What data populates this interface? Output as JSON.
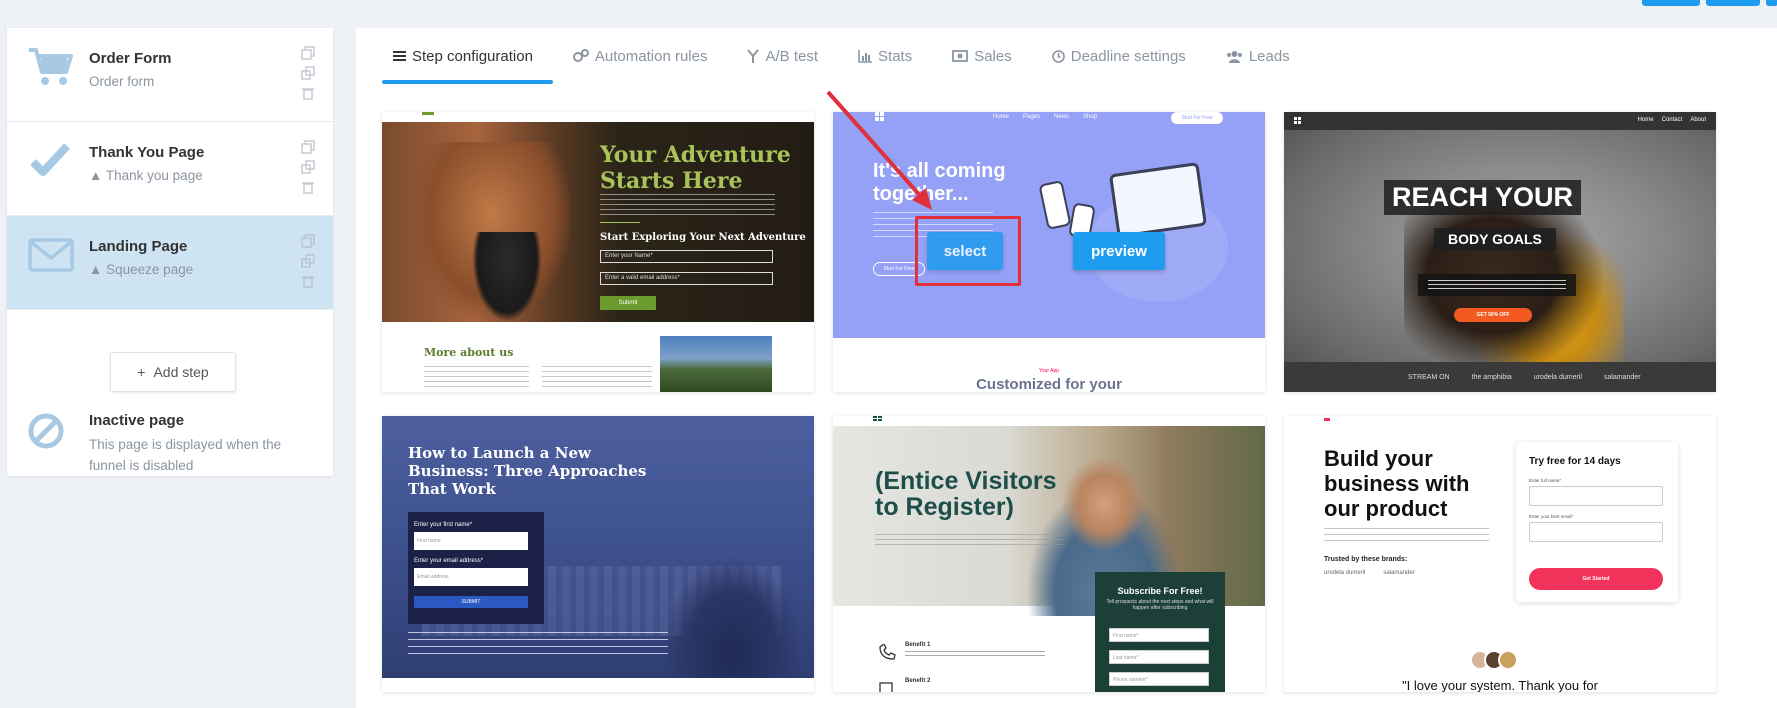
{
  "sidebar": {
    "steps": [
      {
        "title": "Order Form",
        "subtitle": "Order form",
        "icon": "cart-icon"
      },
      {
        "title": "Thank You Page",
        "subtitle": "Thank you page",
        "icon": "checkmark-icon"
      },
      {
        "title": "Landing Page",
        "subtitle": "Squeeze page",
        "icon": "envelope-icon"
      }
    ],
    "add_step": "Add step",
    "inactive": {
      "title": "Inactive page",
      "description": "This page is displayed when the funnel is disabled"
    }
  },
  "tabs": [
    {
      "label": "Step configuration",
      "icon": "list-icon"
    },
    {
      "label": "Automation rules",
      "icon": "gears-icon"
    },
    {
      "label": "A/B test",
      "icon": "split-icon"
    },
    {
      "label": "Stats",
      "icon": "bar-chart-icon"
    },
    {
      "label": "Sales",
      "icon": "money-icon"
    },
    {
      "label": "Deadline settings",
      "icon": "clock-icon"
    },
    {
      "label": "Leads",
      "icon": "users-icon"
    }
  ],
  "templates": {
    "t1": {
      "title": "Your Adventure Starts Here",
      "subtitle": "Start Exploring Your Next Adventure",
      "name_placeholder": "Enter your Name*",
      "email_placeholder": "Enter a valid email address*",
      "submit": "Submit",
      "more": "More about us"
    },
    "t2": {
      "nav": [
        "Home",
        "Pages",
        "News",
        "Shop"
      ],
      "start": "Start For Free",
      "title": "It's all coming together...",
      "ghost": "Start For Free",
      "select": "select",
      "preview": "preview",
      "your_app": "Your App",
      "customized": "Customized for your"
    },
    "t3": {
      "nav": [
        "Home",
        "Contact",
        "About"
      ],
      "reach": "REACH YOUR",
      "body_goals": "BODY GOALS",
      "cta": "GET 50% OFF",
      "stream": "STREAM ON",
      "brands": [
        "the amphibia",
        "urodela dumeril",
        "salamander"
      ]
    },
    "t4": {
      "title": "How to Launch a New Business: Three Approaches That Work",
      "first_label": "Enter your first name*",
      "first_placeholder": "First name",
      "email_label": "Enter your email address*",
      "email_placeholder": "Email address",
      "submit": "SUBMIT"
    },
    "t5": {
      "title": "(Entice Visitors to Register)",
      "benefit1": "Benefit 1",
      "benefit2": "Benefit 2",
      "subscribe": "Subscribe For Free!",
      "subscribe_desc": "Tell prospects about the next steps and what will happen after subscribing",
      "first": "First name*",
      "last": "Last name*",
      "phone": "Phone number*"
    },
    "t6": {
      "title": "Build your business with our product",
      "trusted": "Trusted by these brands:",
      "brands": [
        "urodela dumeril",
        "salamander"
      ],
      "panel_title": "Try free for 14 days",
      "name_label": "Enter full name*",
      "email_label": "Enter your best email*",
      "cta": "Get Started",
      "quote": "\"I love your system. Thank you for"
    }
  },
  "colors": {
    "accent": "#1e9cf0",
    "highlight": "#e0303c",
    "active_step": "#cfe4f3",
    "icon": "#a7c9e4"
  }
}
